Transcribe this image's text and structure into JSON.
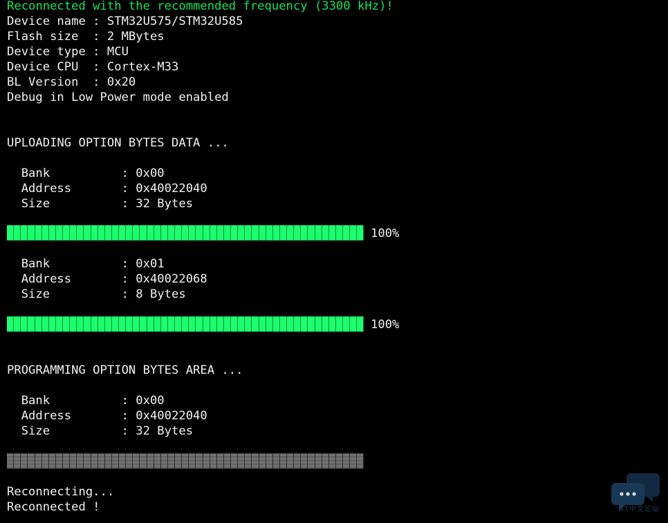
{
  "colors": {
    "background": "#000000",
    "text": "#f2f2f2",
    "success": "#16e35a",
    "progress_fill": "#1bff6e"
  },
  "header": {
    "reconnect_msg": "Reconnected with the recommended frequency (3300 kHz)!"
  },
  "device_info": {
    "name_line": "Device name : STM32U575/STM32U585",
    "flash_line": "Flash size  : 2 MBytes",
    "type_line": "Device type : MCU",
    "cpu_line": "Device CPU  : Cortex-M33",
    "bl_line": "BL Version  : 0x20",
    "debug_line": "Debug in Low Power mode enabled"
  },
  "upload": {
    "heading": "UPLOADING OPTION BYTES DATA ...",
    "blocks": [
      {
        "bank_line": "  Bank          : 0x00",
        "address_line": "  Address       : 0x40022040",
        "size_line": "  Size          : 32 Bytes",
        "progress": 1.0,
        "percent_label": "100%"
      },
      {
        "bank_line": "  Bank          : 0x01",
        "address_line": "  Address       : 0x40022068",
        "size_line": "  Size          : 8 Bytes",
        "progress": 1.0,
        "percent_label": "100%"
      }
    ]
  },
  "program": {
    "heading": "PROGRAMMING OPTION BYTES AREA ...",
    "bank_line": "  Bank          : 0x00",
    "address_line": "  Address       : 0x40022040",
    "size_line": "  Size          : 32 Bytes",
    "progress": 0.0
  },
  "footer": {
    "reconnecting": "Reconnecting...",
    "reconnected": "Reconnected !"
  },
  "watermark": {
    "icon": "chat-bubbles-icon",
    "text": "ST中文论坛"
  }
}
